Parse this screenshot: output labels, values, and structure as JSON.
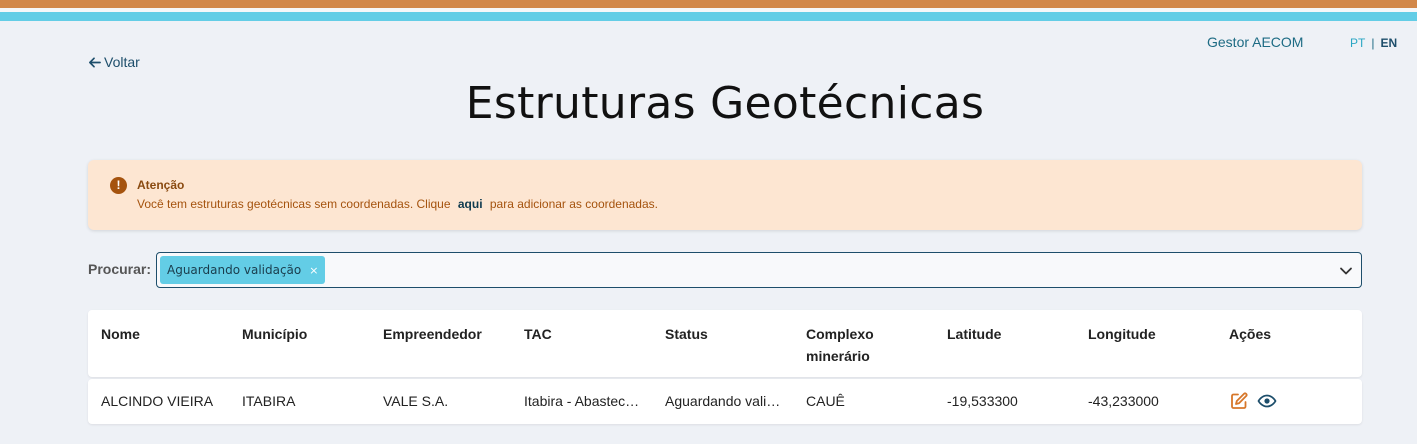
{
  "header": {
    "back_label": "Voltar",
    "user_name": "Gestor AECOM",
    "lang_pt": "PT",
    "lang_sep": "|",
    "lang_en": "EN"
  },
  "page": {
    "title": "Estruturas Geotécnicas"
  },
  "alert": {
    "title": "Atenção",
    "message_before": "Você tem estruturas geotécnicas sem coordenadas. Clique",
    "link_label": "aqui",
    "message_after": "para adicionar as coordenadas."
  },
  "search": {
    "label": "Procurar:",
    "chip_label": "Aguardando validação",
    "chip_remove": "×"
  },
  "table": {
    "headers": {
      "nome": "Nome",
      "municipio": "Município",
      "empreendedor": "Empreendedor",
      "tac": "TAC",
      "status": "Status",
      "complexo": "Complexo minerário",
      "latitude": "Latitude",
      "longitude": "Longitude",
      "acoes": "Ações"
    },
    "rows": [
      {
        "nome": "ALCINDO VIEIRA",
        "municipio": "ITABIRA",
        "empreendedor": "VALE S.A.",
        "tac": "Itabira - Abastecimento",
        "status": "Aguardando validação",
        "complexo": "CAUÊ",
        "latitude": "-19,533300",
        "longitude": "-43,233000",
        "actions": [
          "edit-icon",
          "eye-icon"
        ]
      }
    ]
  },
  "colors": {
    "top_bar_orange": "#d2884a",
    "top_bar_cyan": "#63cde6",
    "alert_bg": "#fde6d2",
    "accent_dark": "#1d4e6b",
    "edit_icon": "#d7772a"
  }
}
